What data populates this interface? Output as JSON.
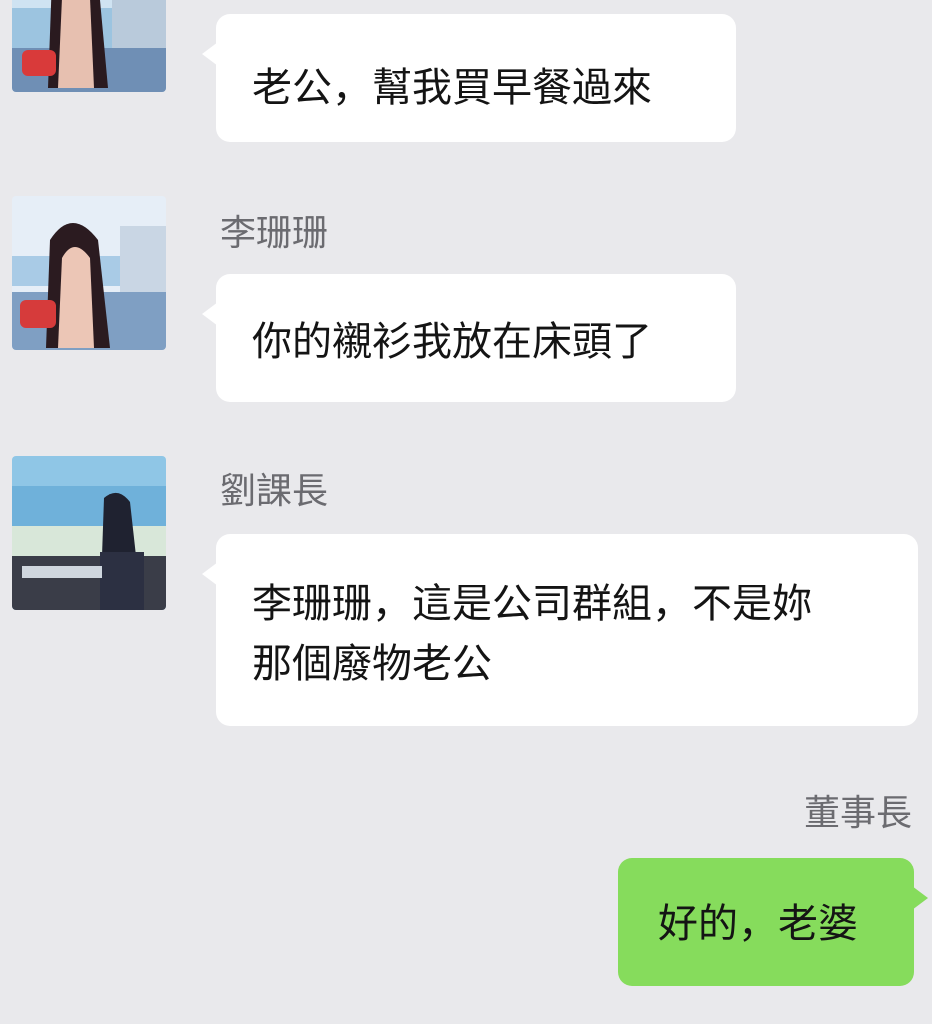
{
  "colors": {
    "background": "#e9e9ec",
    "incoming_bubble": "#ffffff",
    "outgoing_bubble": "#86dc5c",
    "sender_name": "#6b6b70",
    "message_text": "#141414"
  },
  "messages": [
    {
      "sender": "",
      "text": "老公，幫我買早餐過來",
      "direction": "incoming",
      "avatar": "woman-long-hair-avatar"
    },
    {
      "sender": "李珊珊",
      "text": "你的襯衫我放在床頭了",
      "direction": "incoming",
      "avatar": "woman-long-hair-avatar"
    },
    {
      "sender": "劉課長",
      "text": "李珊珊，這是公司群組，不是妳那個廢物老公",
      "line1": "李珊珊，這是公司群組，不是妳",
      "line2": "那個廢物老公",
      "direction": "incoming",
      "avatar": "beach-person-avatar"
    },
    {
      "sender": "董事長",
      "text": "好的，老婆",
      "direction": "outgoing"
    }
  ]
}
